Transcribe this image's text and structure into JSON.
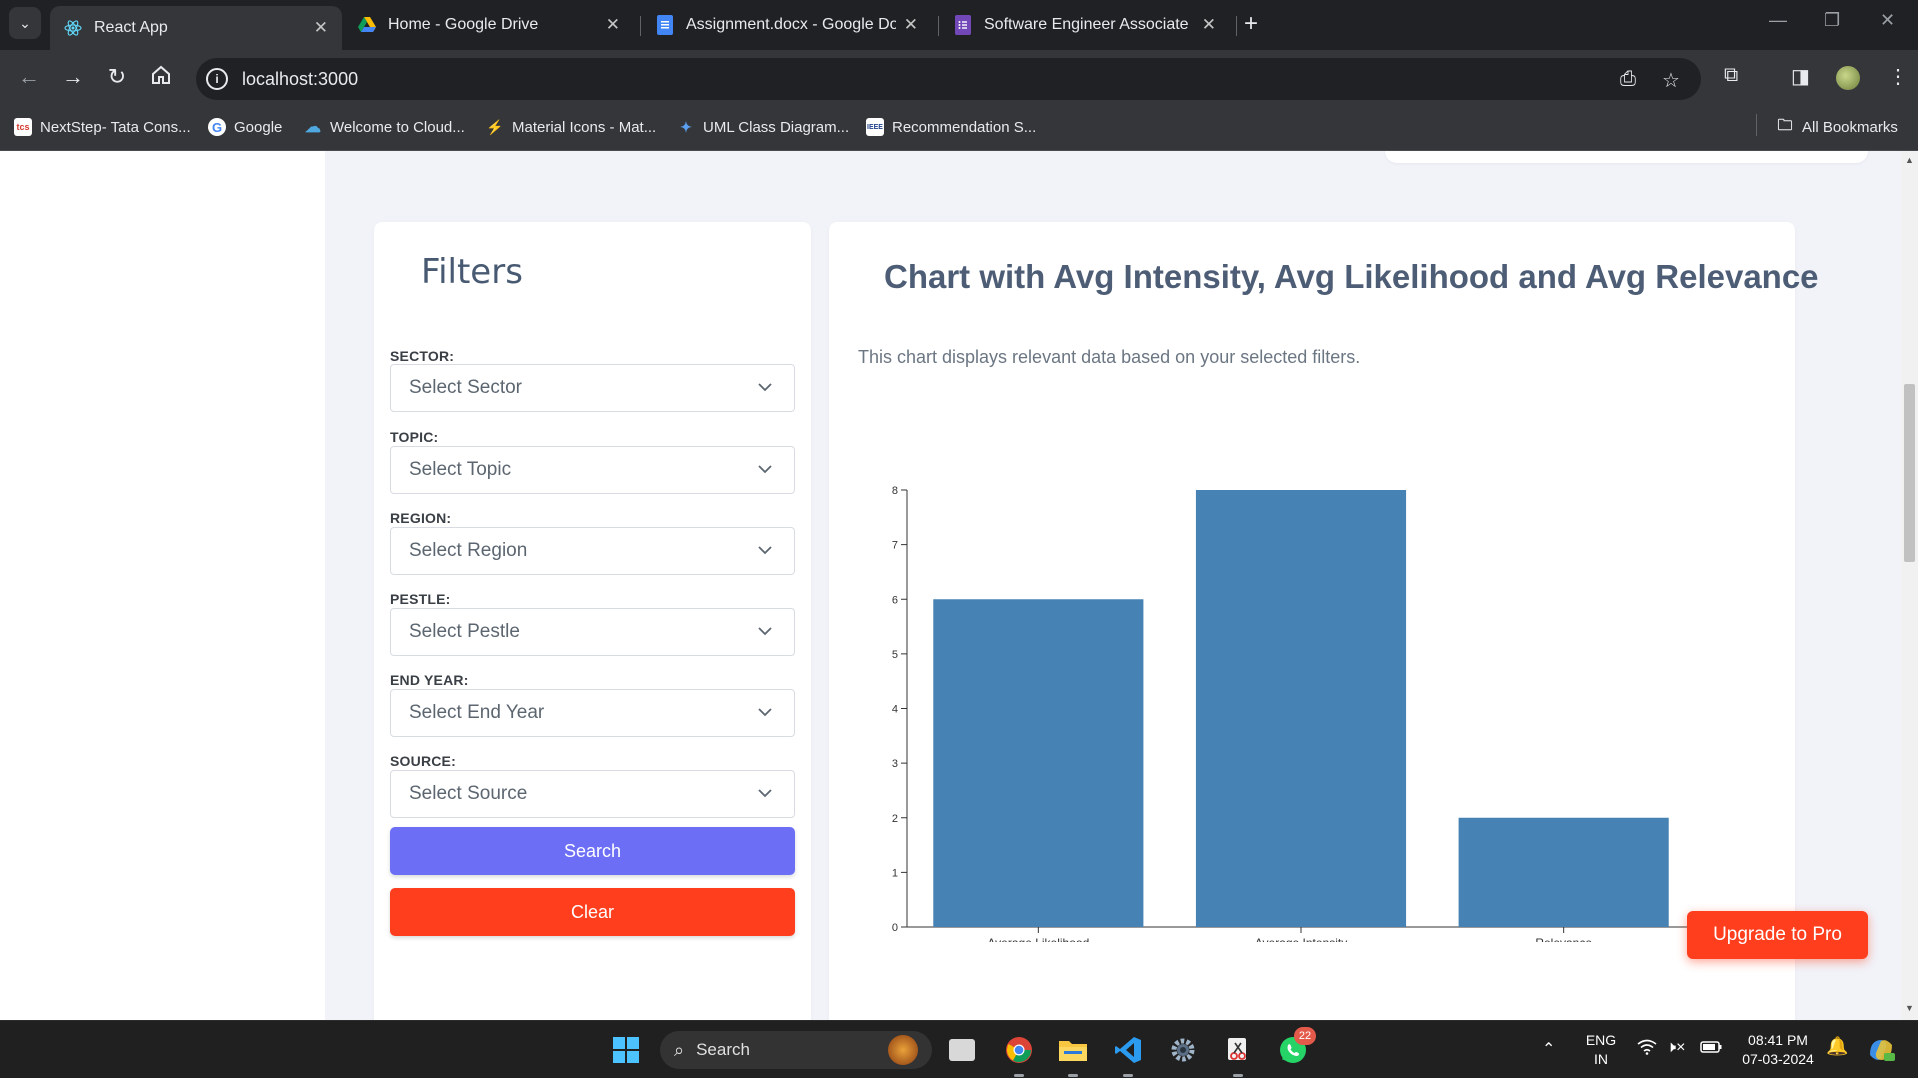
{
  "browser": {
    "tabs": [
      {
        "title": "React App",
        "icon": "react-icon",
        "active": true
      },
      {
        "title": "Home - Google Drive",
        "icon": "google-drive-icon",
        "active": false
      },
      {
        "title": "Assignment.docx - Google Doc",
        "icon": "google-docs-icon",
        "active": false
      },
      {
        "title": "Software Engineer Associate",
        "icon": "google-forms-icon",
        "active": false
      }
    ],
    "url": "localhost:3000",
    "bookmarks": [
      {
        "label": "NextStep- Tata Cons...",
        "icon": "tcs-icon"
      },
      {
        "label": "Google",
        "icon": "google-icon"
      },
      {
        "label": "Welcome to Cloud...",
        "icon": "cloud-icon"
      },
      {
        "label": "Material Icons - Mat...",
        "icon": "material-icon"
      },
      {
        "label": "UML Class Diagram...",
        "icon": "uml-icon"
      },
      {
        "label": "Recommendation S...",
        "icon": "ieee-icon"
      }
    ],
    "all_bookmarks": "All Bookmarks"
  },
  "filters": {
    "title": "Filters",
    "fields": [
      {
        "label": "SECTOR:",
        "placeholder": "Select Sector"
      },
      {
        "label": "TOPIC:",
        "placeholder": "Select Topic"
      },
      {
        "label": "REGION:",
        "placeholder": "Select Region"
      },
      {
        "label": "PESTLE:",
        "placeholder": "Select Pestle"
      },
      {
        "label": "END YEAR:",
        "placeholder": "Select End Year"
      },
      {
        "label": "SOURCE:",
        "placeholder": "Select Source"
      }
    ],
    "search_label": "Search",
    "clear_label": "Clear"
  },
  "chart": {
    "title": "Chart with Avg Intensity, Avg Likelihood and Avg Relevance",
    "description": "This chart displays relevant data based on your selected filters."
  },
  "chart_data": {
    "type": "bar",
    "categories": [
      "Average Likelihood",
      "Average Intensity",
      "Relevance"
    ],
    "values": [
      6,
      8,
      2
    ],
    "ylim": [
      0,
      8
    ],
    "yticks": [
      0,
      1,
      2,
      3,
      4,
      5,
      6,
      7,
      8
    ],
    "bar_color": "#4682b4",
    "grid": false,
    "legend": "none"
  },
  "upgrade_label": "Upgrade to Pro",
  "taskbar": {
    "search_label": "Search",
    "whatsapp_badge": "22",
    "language": "ENG",
    "region": "IN",
    "time": "08:41 PM",
    "date": "07-03-2024"
  },
  "colors": {
    "primary": "#6c6ef6",
    "danger": "#ff3e1d",
    "bar": "#4682b4"
  }
}
